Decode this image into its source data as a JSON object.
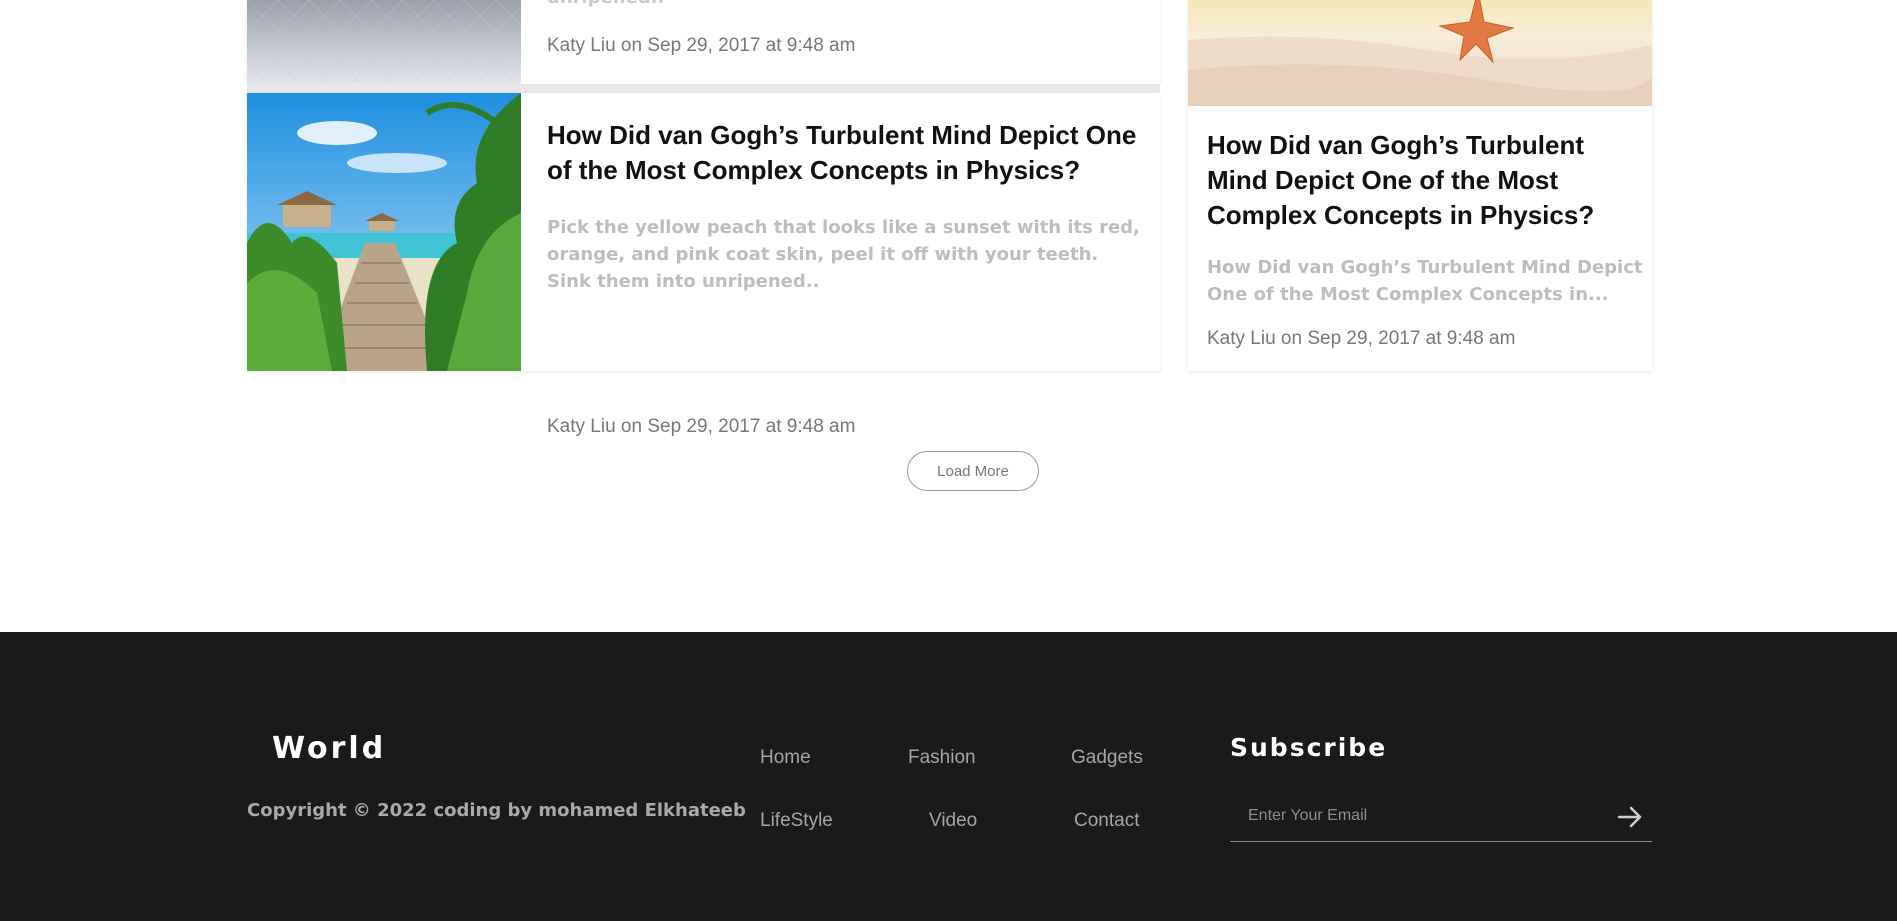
{
  "cards": {
    "top": {
      "excerpt_tail": "unripened..",
      "meta": "Katy Liu on Sep 29, 2017 at 9:48 am",
      "image": "grey-tiles-image"
    },
    "main": {
      "title": "How Did van Gogh’s Turbulent Mind Depict One of the Most Complex Concepts in Physics?",
      "excerpt": "Pick the yellow peach that looks like a sunset with its red, orange, and pink coat skin, peel it off with your teeth. Sink them into unripened..",
      "meta": "Katy Liu on Sep 29, 2017 at 9:48 am",
      "image": "tropical-boardwalk-image"
    },
    "side": {
      "title": "How Did van Gogh’s Turbulent Mind Depict One of the Most Complex Concepts in Physics?",
      "excerpt": "How Did van Gogh’s Turbulent Mind Depict One of the Most Complex Concepts in...",
      "meta": "Katy Liu on Sep 29, 2017 at 9:48 am",
      "image": "starfish-sand-image"
    }
  },
  "load_more_label": "Load More",
  "footer": {
    "logo": "World",
    "copyright": "Copyright © 2022 coding by mohamed Elkhateeb",
    "nav": [
      "Home",
      "Fashion",
      "Gadgets",
      "LifeStyle",
      "Video",
      "Contact"
    ],
    "subscribe": {
      "title": "Subscribe",
      "placeholder": "Enter Your Email",
      "submit_icon": "arrow-right-icon"
    }
  },
  "colors": {
    "footer_bg": "#1a1a1a",
    "title_text": "#111111",
    "excerpt_text": "#bdbdbd",
    "meta_text": "#777777"
  }
}
